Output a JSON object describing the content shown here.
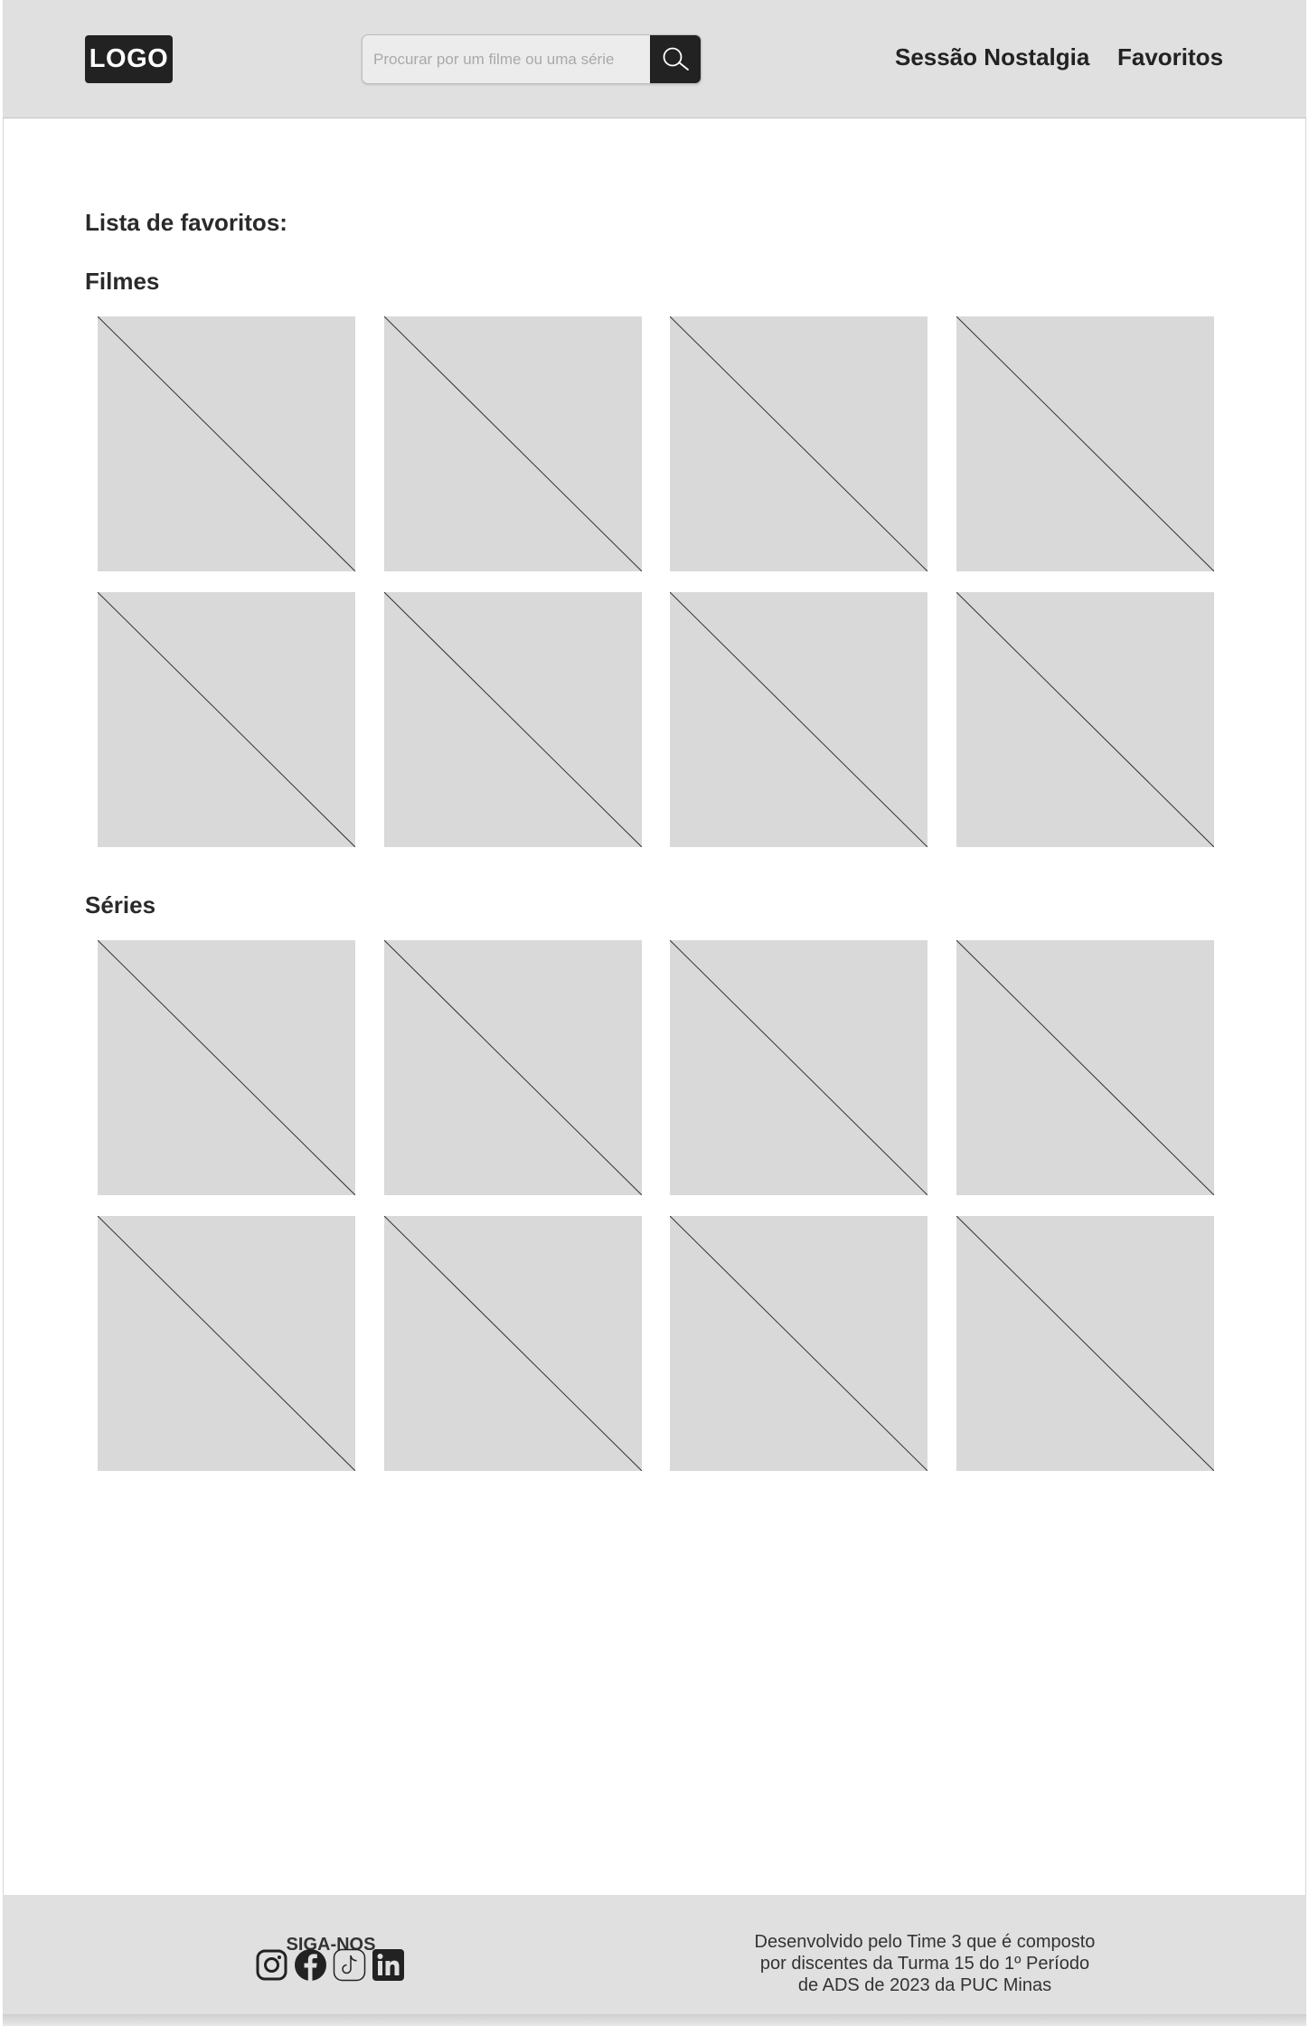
{
  "header": {
    "logo": "LOGO",
    "search": {
      "placeholder": "Procurar por um filme ou uma série",
      "value": ""
    },
    "nav": {
      "nostalgia": "Sessão Nostalgia",
      "favorites": "Favoritos"
    }
  },
  "main": {
    "list_title": "Lista de favoritos:",
    "movies_title": "Filmes",
    "series_title": "Séries"
  },
  "footer": {
    "follow_title": "SIGA-NOS",
    "social_icons": [
      "instagram-icon",
      "facebook-icon",
      "tiktok-icon",
      "linkedin-icon"
    ],
    "credits_line1": "Desenvolvido pelo Time 3 que é composto",
    "credits_line2": "por discentes da Turma 15 do 1º Período",
    "credits_line3": "de ADS de 2023 da PUC Minas"
  },
  "colors": {
    "header_bg": "#e0e0e0",
    "placeholder_bg": "#d9d9d9",
    "dark": "#222222"
  }
}
